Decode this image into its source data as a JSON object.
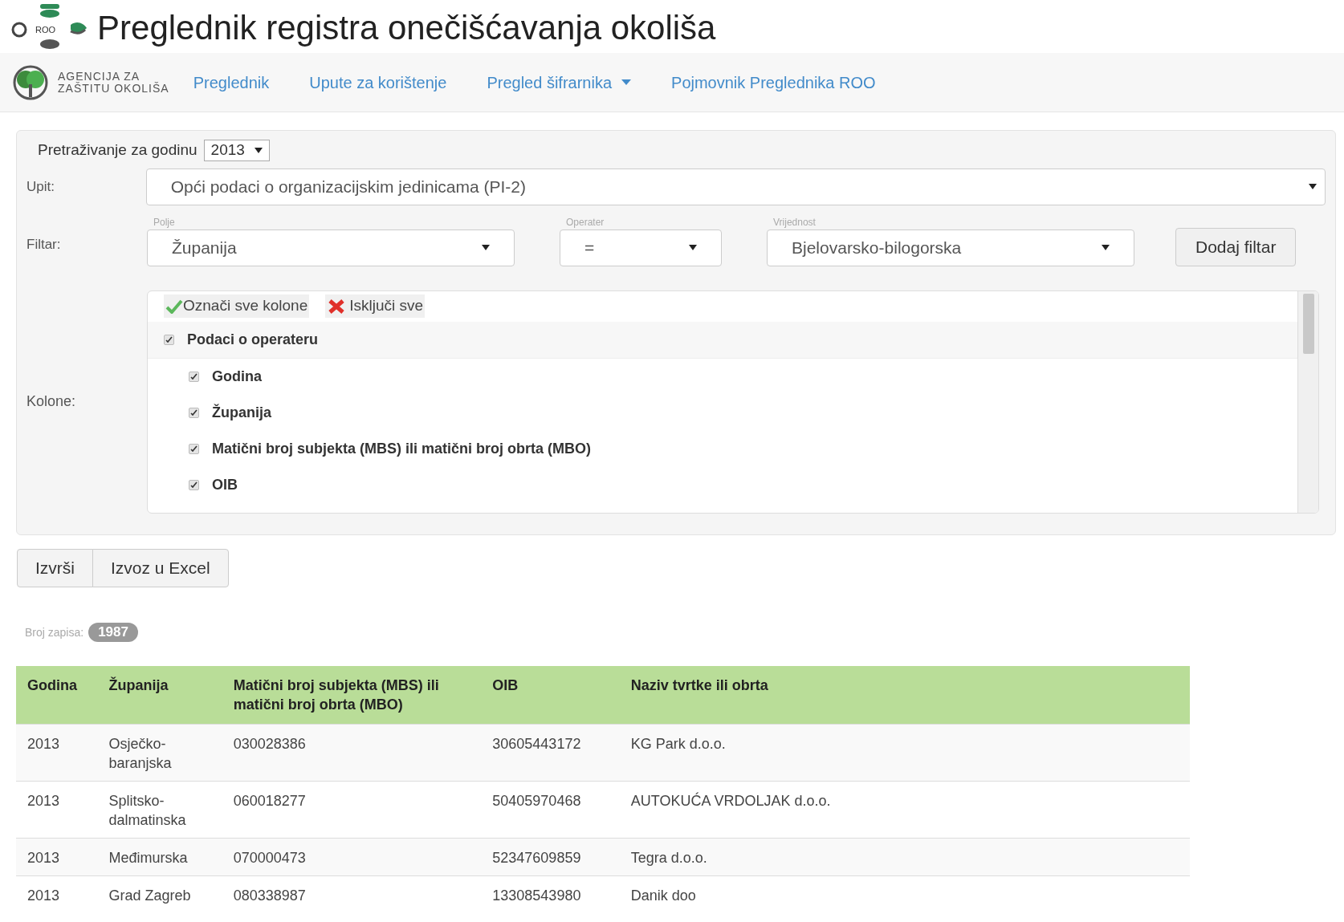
{
  "header": {
    "logo_text": "ROO",
    "title": "Preglednik registra onečišćavanja okoliša"
  },
  "nav": {
    "agency": [
      "AGENCIJA ZA",
      "ZAŠTITU OKOLIŠA"
    ],
    "items": [
      {
        "label": "Preglednik",
        "dropdown": false
      },
      {
        "label": "Upute za korištenje",
        "dropdown": false
      },
      {
        "label": "Pregled šifrarnika",
        "dropdown": true
      },
      {
        "label": "Pojmovnik Preglednika ROO",
        "dropdown": false
      }
    ]
  },
  "search": {
    "year_label": "Pretraživanje za godinu",
    "year": "2013",
    "query_label": "Upit:",
    "query": "Opći podaci o organizacijskim jedinicama (PI-2)",
    "filter_label": "Filtar:",
    "filters": [
      {
        "caption": "Polje",
        "value": "Županija"
      },
      {
        "caption": "Operater",
        "value": "="
      },
      {
        "caption": "Vrijednost",
        "value": "Bjelovarsko-bilogorska"
      }
    ],
    "add_filter": "Dodaj filtar",
    "columns_label": "Kolone:",
    "select_all": "Označi sve kolone",
    "deselect_all": "Isključi sve",
    "groups": [
      {
        "label": "Podaci o operateru",
        "checked": true,
        "children": [
          {
            "label": "Godina",
            "checked": true
          },
          {
            "label": "Županija",
            "checked": true
          },
          {
            "label": "Matični broj subjekta (MBS) ili matični broj obrta (MBO)",
            "checked": true
          },
          {
            "label": "OIB",
            "checked": true
          }
        ]
      }
    ]
  },
  "actions": [
    "Izvrši",
    "Izvoz u Excel"
  ],
  "count": {
    "label": "Broj zapisa:",
    "value": "1987"
  },
  "table": {
    "columns": [
      "Godina",
      "Županija",
      "Matični broj subjekta (MBS) ili matični broj obrta (MBO)",
      "OIB",
      "Naziv tvrtke ili obrta"
    ],
    "rows": [
      [
        "2013",
        "Osječko-baranjska",
        "030028386",
        "30605443172",
        "KG Park d.o.o."
      ],
      [
        "2013",
        "Splitsko-dalmatinska",
        "060018277",
        "50405970468",
        "AUTOKUĆA VRDOLJAK d.o.o."
      ],
      [
        "2013",
        "Međimurska",
        "070000473",
        "52347609859",
        "Tegra d.o.o."
      ],
      [
        "2013",
        "Grad Zagreb",
        "080338987",
        "13308543980",
        "Danik doo"
      ]
    ]
  }
}
